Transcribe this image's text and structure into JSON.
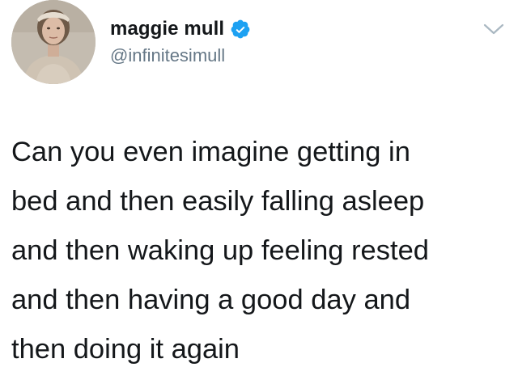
{
  "tweet": {
    "author": {
      "display_name": "maggie mull",
      "handle": "@infinitesimull",
      "verified": true,
      "verified_color": "#1da1f2"
    },
    "menu_icon": "chevron-down-icon",
    "text_lines": [
      "Can you even imagine getting in",
      "bed and then easily falling asleep",
      "and then waking up feeling rested",
      "and then having a good day and",
      "then doing it again"
    ]
  }
}
